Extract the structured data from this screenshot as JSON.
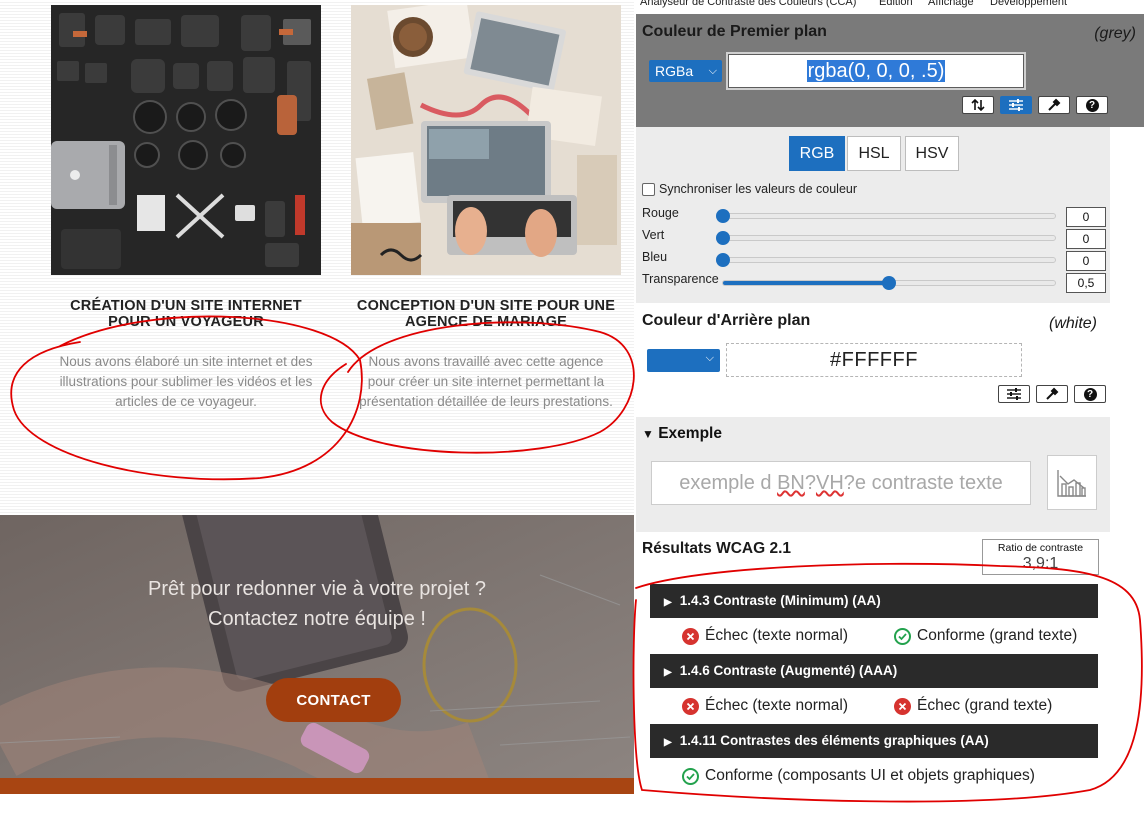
{
  "site": {
    "cards": [
      {
        "title_line1": "CRÉATION D'UN SITE INTERNET",
        "title_line2": "POUR UN VOYAGEUR",
        "text_line1": "Nous avons élaboré un site internet et des",
        "text_line2": "illustrations pour sublimer les vidéos et les",
        "text_line3": "articles de ce voyageur."
      },
      {
        "title_line1": "CONCEPTION D'UN SITE POUR UNE",
        "title_line2": "AGENCE DE MARIAGE",
        "text_line1": "Nous avons travaillé avec cette agence",
        "text_line2": "pour créer un site internet permettant la",
        "text_line3": "présentation détaillée de leurs prestations."
      }
    ],
    "hero": {
      "line1": "Prêt pour redonner vie à votre projet ?",
      "line2": "Contactez notre équipe !",
      "button": "CONTACT"
    }
  },
  "cca": {
    "menu": [
      "Analyseur de Contraste des Couleurs (CCA)",
      "Edition",
      "Affichage",
      "Développement"
    ],
    "foreground": {
      "title": "Couleur de Premier plan",
      "name": "(grey)",
      "format": "RGBa",
      "value": "rgba(0, 0, 0, .5)",
      "tabs": [
        "RGB",
        "HSL",
        "HSV"
      ],
      "active_tab": "RGB",
      "sync_label": "Synchroniser les valeurs de couleur",
      "channels": [
        {
          "label": "Rouge",
          "value": "0",
          "level": 0
        },
        {
          "label": "Vert",
          "value": "0",
          "level": 0
        },
        {
          "label": "Bleu",
          "value": "0",
          "level": 0
        },
        {
          "label": "Transparence",
          "value": "0,5",
          "level": 0.5
        }
      ]
    },
    "background": {
      "title": "Couleur d'Arrière plan",
      "name": "(white)",
      "value": "#FFFFFF"
    },
    "example": {
      "header": "Exemple",
      "text_prefix": "exemple d ",
      "text_err1": "BN",
      "text_mid": "?",
      "text_err2": "VH",
      "text_suffix": "?e contraste texte"
    },
    "results": {
      "title": "Résultats WCAG 2.1",
      "ratio_label": "Ratio de contraste",
      "ratio_value": "3,9:1",
      "criteria": [
        {
          "label": "1.4.3 Contraste (Minimum) (AA)",
          "left": "Échec (texte normal)",
          "right": "Conforme (grand texte)"
        },
        {
          "label": "1.4.6 Contraste (Augmenté) (AAA)",
          "left": "Échec (texte normal)",
          "right": "Échec (grand texte)"
        },
        {
          "label": "1.4.11 Contrastes des éléments graphiques (AA)",
          "left": "Conforme (composants UI et objets graphiques)"
        }
      ]
    },
    "colors": {
      "accent": "#1d6fbf",
      "fail": "#d6332f",
      "pass": "#23a24d",
      "annotation": "#e00000"
    }
  }
}
